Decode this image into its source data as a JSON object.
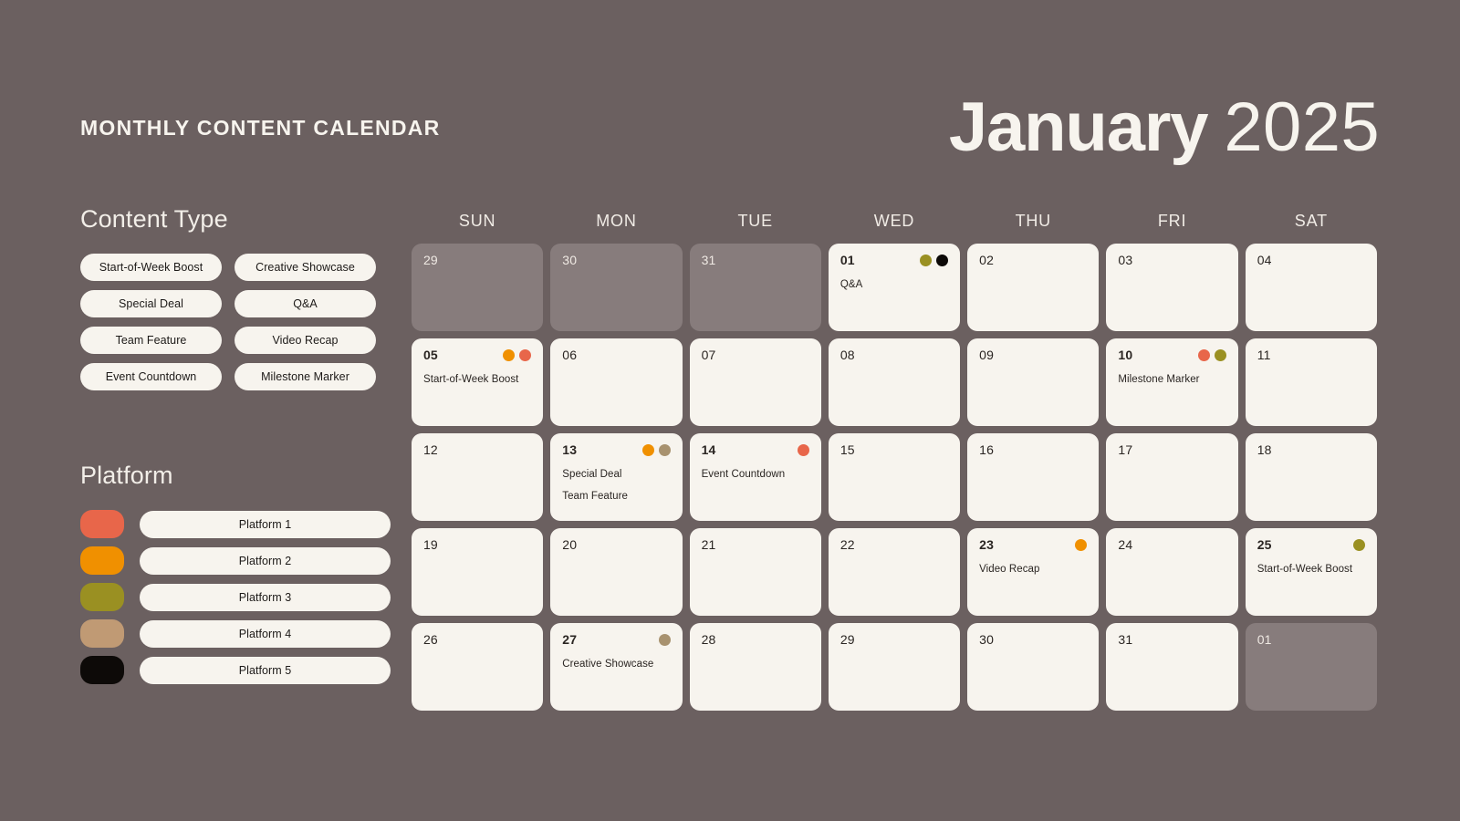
{
  "header": {
    "brand_title": "MONTHLY CONTENT CALENDAR",
    "month": "January",
    "year": "2025"
  },
  "palette": {
    "background": "#6b6060",
    "card": "#f7f4ee",
    "out_of_month": "#877c7c",
    "text_dark": "#2a2522",
    "text_light": "#f2eee8"
  },
  "sidebar": {
    "content_type": {
      "title": "Content Type",
      "items": [
        {
          "label": "Start-of-Week Boost"
        },
        {
          "label": "Creative Showcase"
        },
        {
          "label": "Special Deal"
        },
        {
          "label": "Q&A"
        },
        {
          "label": "Team Feature"
        },
        {
          "label": "Video Recap"
        },
        {
          "label": "Event Countdown"
        },
        {
          "label": "Milestone Marker"
        }
      ]
    },
    "platform": {
      "title": "Platform",
      "items": [
        {
          "label": "Platform 1",
          "color": "#e8664a"
        },
        {
          "label": "Platform 2",
          "color": "#f09000"
        },
        {
          "label": "Platform 3",
          "color": "#9a9022"
        },
        {
          "label": "Platform 4",
          "color": "#c09a74"
        },
        {
          "label": "Platform 5",
          "color": "#0d0a08"
        }
      ]
    }
  },
  "calendar": {
    "day_headers": [
      "SUN",
      "MON",
      "TUE",
      "WED",
      "THU",
      "FRI",
      "SAT"
    ],
    "weeks": [
      [
        {
          "day": "29",
          "out": true,
          "dots": [],
          "events": []
        },
        {
          "day": "30",
          "out": true,
          "dots": [],
          "events": []
        },
        {
          "day": "31",
          "out": true,
          "dots": [],
          "events": []
        },
        {
          "day": "01",
          "out": false,
          "dots": [
            "#9a9022",
            "#0d0a08"
          ],
          "events": [
            "Q&A"
          ]
        },
        {
          "day": "02",
          "out": false,
          "dots": [],
          "events": []
        },
        {
          "day": "03",
          "out": false,
          "dots": [],
          "events": []
        },
        {
          "day": "04",
          "out": false,
          "dots": [],
          "events": []
        }
      ],
      [
        {
          "day": "05",
          "out": false,
          "dots": [
            "#f09000",
            "#e8664a"
          ],
          "events": [
            "Start-of-Week Boost"
          ]
        },
        {
          "day": "06",
          "out": false,
          "dots": [],
          "events": []
        },
        {
          "day": "07",
          "out": false,
          "dots": [],
          "events": []
        },
        {
          "day": "08",
          "out": false,
          "dots": [],
          "events": []
        },
        {
          "day": "09",
          "out": false,
          "dots": [],
          "events": []
        },
        {
          "day": "10",
          "out": false,
          "dots": [
            "#e8664a",
            "#9a9022"
          ],
          "events": [
            "Milestone Marker"
          ]
        },
        {
          "day": "11",
          "out": false,
          "dots": [],
          "events": []
        }
      ],
      [
        {
          "day": "12",
          "out": false,
          "dots": [],
          "events": []
        },
        {
          "day": "13",
          "out": false,
          "dots": [
            "#f09000",
            "#a8926f"
          ],
          "events": [
            "Special Deal",
            "Team Feature"
          ]
        },
        {
          "day": "14",
          "out": false,
          "dots": [
            "#e8664a"
          ],
          "events": [
            "Event Countdown"
          ]
        },
        {
          "day": "15",
          "out": false,
          "dots": [],
          "events": []
        },
        {
          "day": "16",
          "out": false,
          "dots": [],
          "events": []
        },
        {
          "day": "17",
          "out": false,
          "dots": [],
          "events": []
        },
        {
          "day": "18",
          "out": false,
          "dots": [],
          "events": []
        }
      ],
      [
        {
          "day": "19",
          "out": false,
          "dots": [],
          "events": []
        },
        {
          "day": "20",
          "out": false,
          "dots": [],
          "events": []
        },
        {
          "day": "21",
          "out": false,
          "dots": [],
          "events": []
        },
        {
          "day": "22",
          "out": false,
          "dots": [],
          "events": []
        },
        {
          "day": "23",
          "out": false,
          "dots": [
            "#f09000"
          ],
          "events": [
            "Video Recap"
          ]
        },
        {
          "day": "24",
          "out": false,
          "dots": [],
          "events": []
        },
        {
          "day": "25",
          "out": false,
          "dots": [
            "#9a9022"
          ],
          "events": [
            "Start-of-Week Boost"
          ]
        }
      ],
      [
        {
          "day": "26",
          "out": false,
          "dots": [],
          "events": []
        },
        {
          "day": "27",
          "out": false,
          "dots": [
            "#a8926f"
          ],
          "events": [
            "Creative Showcase"
          ]
        },
        {
          "day": "28",
          "out": false,
          "dots": [],
          "events": []
        },
        {
          "day": "29",
          "out": false,
          "dots": [],
          "events": []
        },
        {
          "day": "30",
          "out": false,
          "dots": [],
          "events": []
        },
        {
          "day": "31",
          "out": false,
          "dots": [],
          "events": []
        },
        {
          "day": "01",
          "out": true,
          "dots": [],
          "events": []
        }
      ]
    ]
  }
}
